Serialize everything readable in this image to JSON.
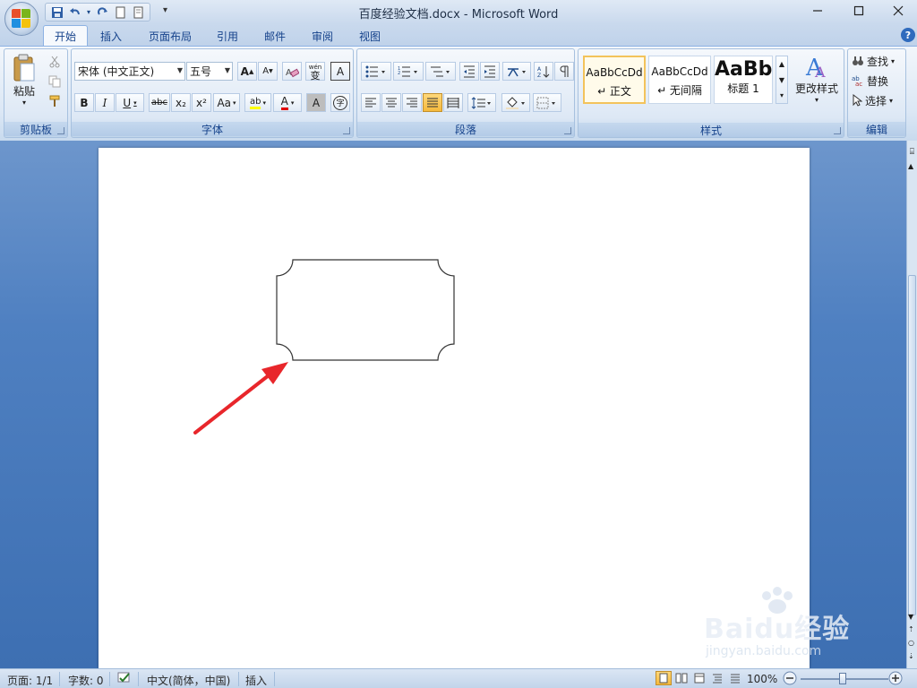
{
  "window": {
    "title": "百度经验文档.docx - Microsoft Word"
  },
  "qat": {
    "more": "▾"
  },
  "tabs": [
    {
      "label": "开始"
    },
    {
      "label": "插入"
    },
    {
      "label": "页面布局"
    },
    {
      "label": "引用"
    },
    {
      "label": "邮件"
    },
    {
      "label": "审阅"
    },
    {
      "label": "视图"
    }
  ],
  "clipboard": {
    "paste_label": "粘贴",
    "group_label": "剪贴板"
  },
  "font": {
    "name": "宋体 (中文正文)",
    "size": "五号",
    "group_label": "字体",
    "bold": "B",
    "italic": "I",
    "underline": "U",
    "strike": "abc",
    "sub": "x₂",
    "sup": "x²",
    "case": "Aa",
    "grow": "A",
    "shrink": "A",
    "wen": "wén",
    "bianzi": "变",
    "charborder": "A",
    "highlight": "ab",
    "fontcolor": "A",
    "shade": "A",
    "enclose": "字"
  },
  "paragraph": {
    "group_label": "段落"
  },
  "styles": {
    "group_label": "样式",
    "change_label": "更改样式",
    "items": [
      {
        "preview": "AaBbCcDd",
        "name": "↵ 正文"
      },
      {
        "preview": "AaBbCcDd",
        "name": "↵ 无间隔"
      },
      {
        "preview": "AaBb",
        "name": "标题 1"
      }
    ]
  },
  "editing": {
    "group_label": "编辑",
    "find": "查找",
    "replace": "替换",
    "select": "选择"
  },
  "status": {
    "page": "页面: 1/1",
    "words": "字数: 0",
    "language": "中文(简体，中国)",
    "mode": "插入",
    "zoom": "100%"
  },
  "watermark": {
    "brand": "Baidu经验",
    "url": "jingyan.baidu.com"
  },
  "colors": {
    "arrow": "#e8262b",
    "ribbon_text": "#15428b",
    "highlight": "#ffff00",
    "font_color": "#e00000"
  }
}
